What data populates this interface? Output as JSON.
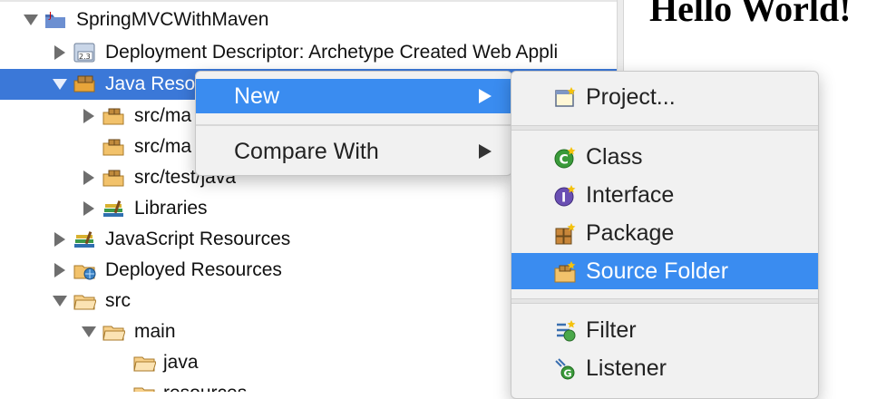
{
  "tree": {
    "items": [
      {
        "label": "SpringMVCWithMaven",
        "icon": "project-icon"
      },
      {
        "label": "Deployment Descriptor: Archetype Created Web Appli",
        "icon": "deployment-descriptor-icon"
      },
      {
        "label": "Java Reso",
        "icon": "java-resources-icon"
      },
      {
        "label": "src/ma",
        "icon": "package-folder-icon"
      },
      {
        "label": "src/ma",
        "icon": "package-folder-icon"
      },
      {
        "label": "src/test/java",
        "icon": "package-folder-icon"
      },
      {
        "label": "Libraries",
        "icon": "libraries-icon"
      },
      {
        "label": "JavaScript Resources",
        "icon": "libraries-icon"
      },
      {
        "label": "Deployed Resources",
        "icon": "deployed-resources-icon"
      },
      {
        "label": "src",
        "icon": "folder-icon"
      },
      {
        "label": "main",
        "icon": "folder-icon"
      },
      {
        "label": "java",
        "icon": "folder-icon"
      },
      {
        "label": "resources",
        "icon": "folder-icon"
      }
    ]
  },
  "preview": {
    "heading": "Hello World!"
  },
  "context_menu": {
    "items": [
      {
        "label": "New",
        "highlighted": true,
        "has_submenu": true
      },
      {
        "label": "Compare With",
        "highlighted": false,
        "has_submenu": true
      }
    ]
  },
  "submenu": {
    "items": [
      {
        "label": "Project...",
        "icon": "new-project-icon"
      },
      {
        "label": "Class",
        "icon": "class-icon"
      },
      {
        "label": "Interface",
        "icon": "interface-icon"
      },
      {
        "label": "Package",
        "icon": "package-icon"
      },
      {
        "label": "Source Folder",
        "icon": "source-folder-icon",
        "highlighted": true
      },
      {
        "label": "Filter",
        "icon": "filter-icon"
      },
      {
        "label": "Listener",
        "icon": "listener-icon"
      }
    ]
  },
  "colors": {
    "selection": "#3b78d8",
    "menu_highlight": "#3a8cf0",
    "menu_background": "#f1f1f1"
  }
}
